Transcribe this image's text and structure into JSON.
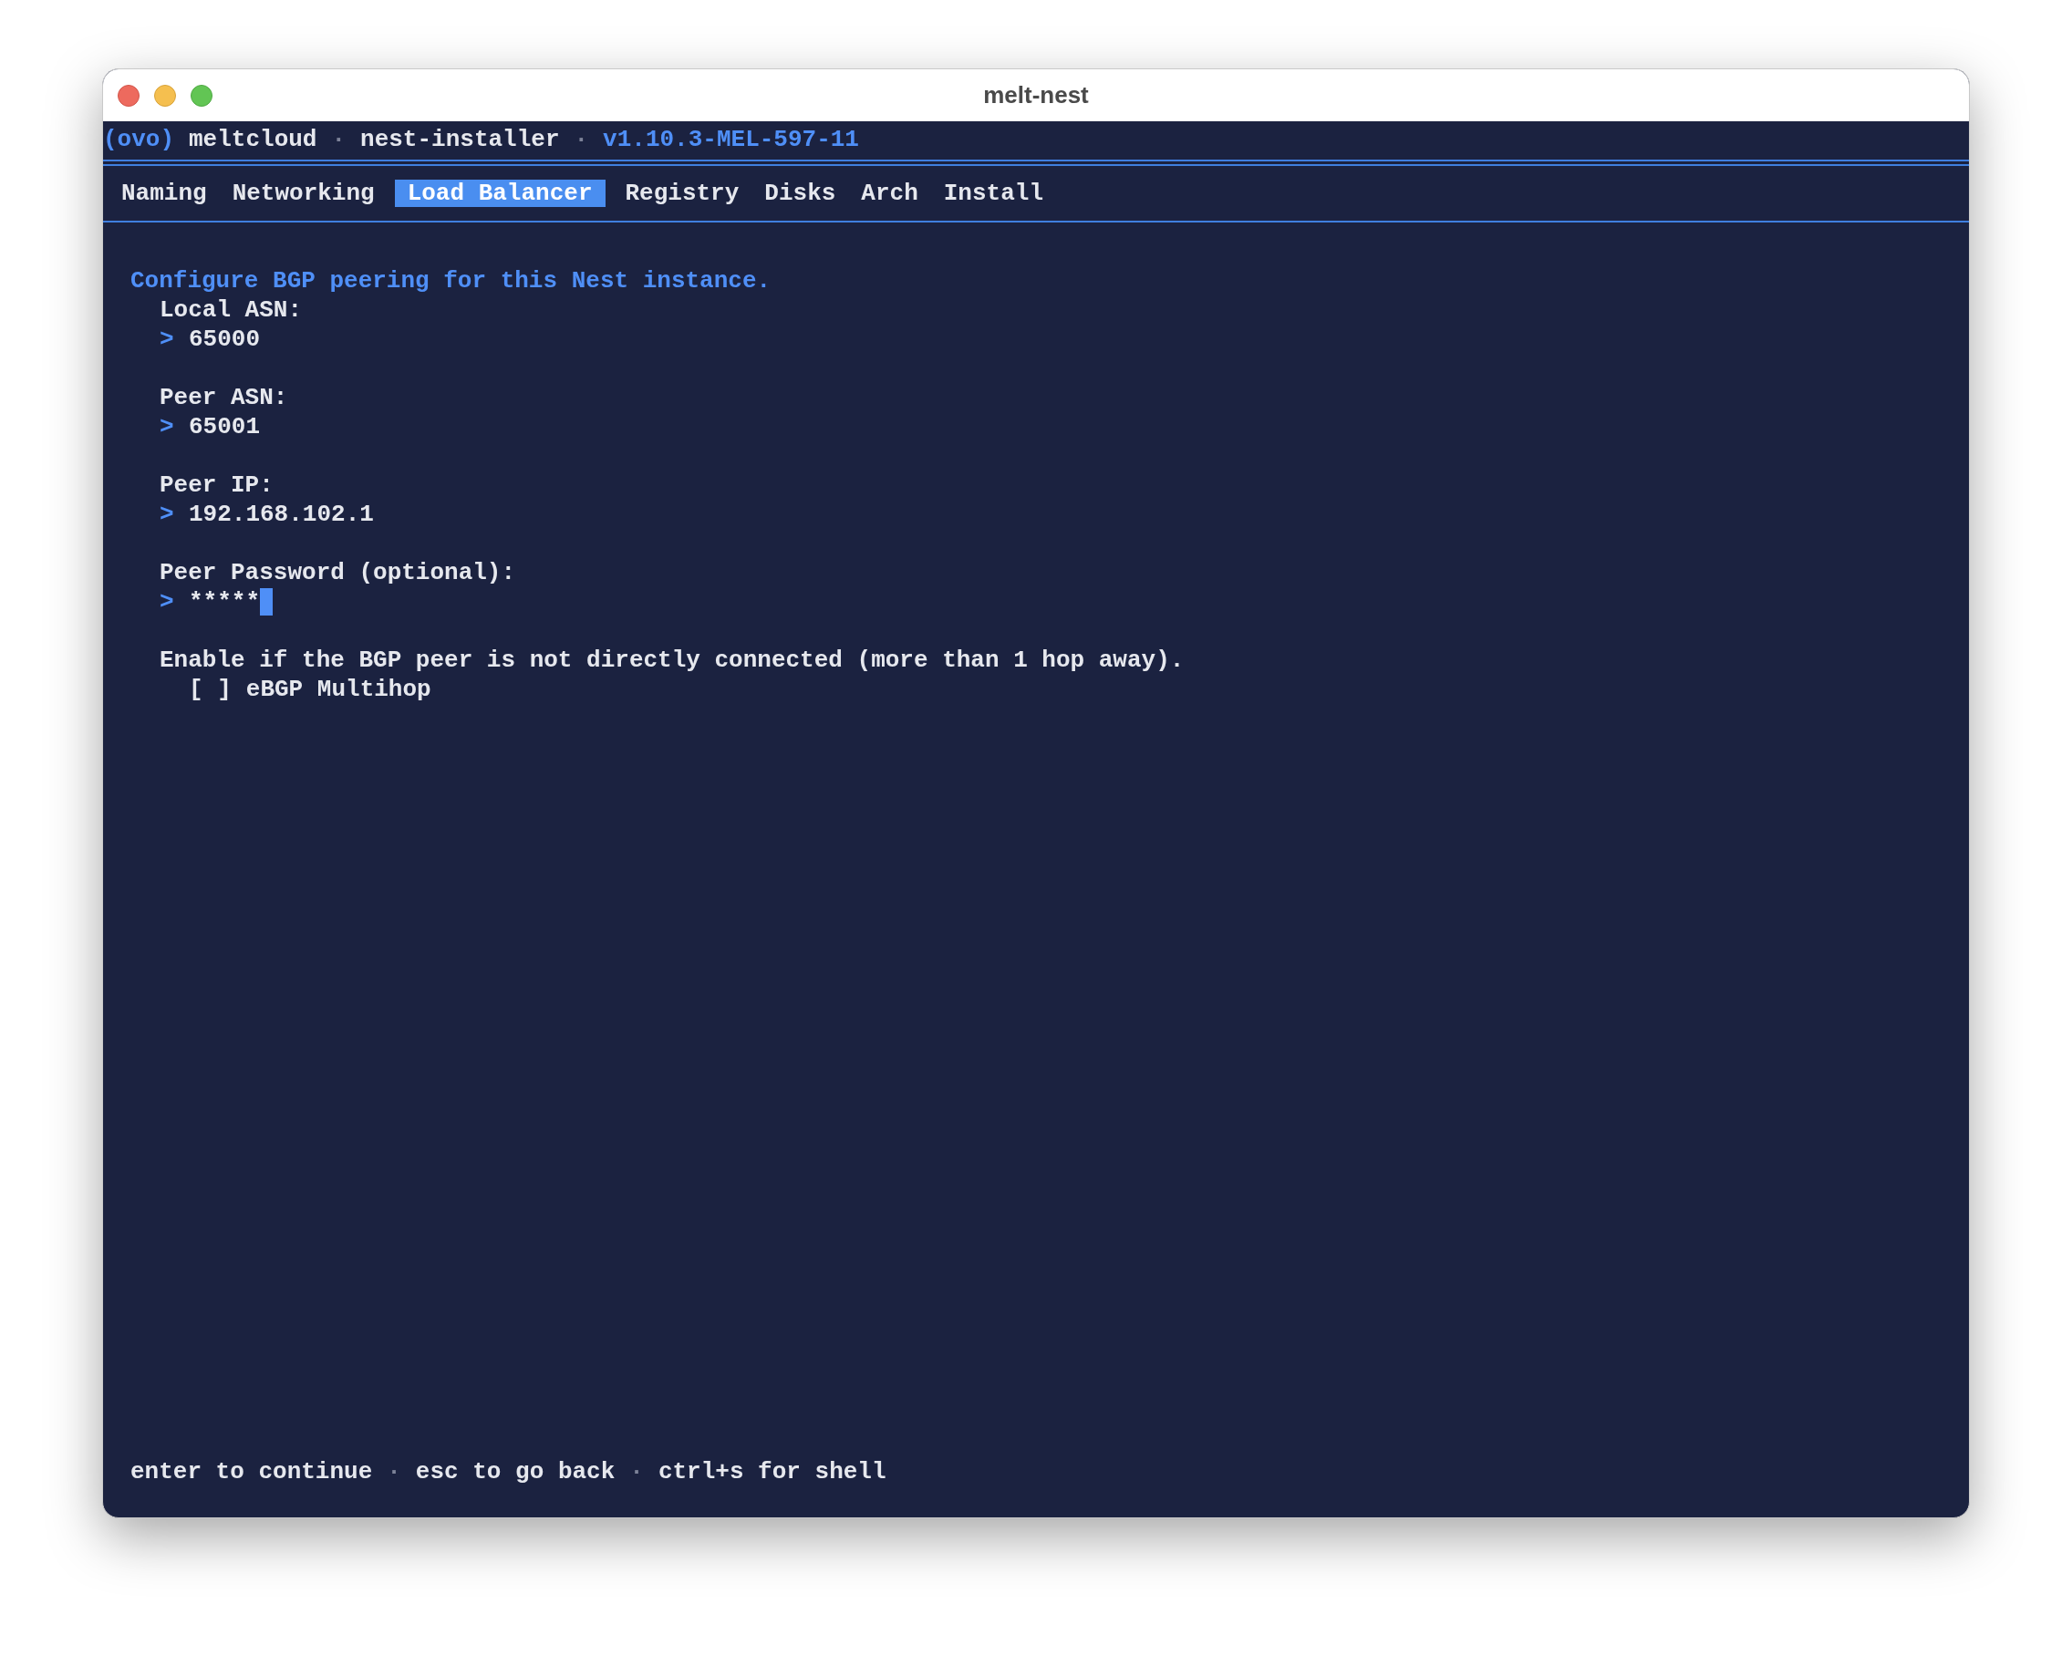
{
  "window": {
    "title": "melt-nest"
  },
  "header": [
    {
      "text": "(ovo)",
      "kind": "accent"
    },
    {
      "text": "meltcloud",
      "kind": "plain"
    },
    {
      "text": "·",
      "kind": "separator"
    },
    {
      "text": "nest-installer",
      "kind": "plain"
    },
    {
      "text": "·",
      "kind": "separator"
    },
    {
      "text": "v1.10.3-MEL-597-11",
      "kind": "accent"
    }
  ],
  "tabs": [
    {
      "label": "Naming",
      "selected": false
    },
    {
      "label": "Networking",
      "selected": false
    },
    {
      "label": "Load Balancer",
      "selected": true
    },
    {
      "label": "Registry",
      "selected": false
    },
    {
      "label": "Disks",
      "selected": false
    },
    {
      "label": "Arch",
      "selected": false
    },
    {
      "label": "Install",
      "selected": false
    }
  ],
  "form": {
    "intro": "Configure BGP peering for this Nest instance.",
    "fields": [
      {
        "kind": "input",
        "label": "Local ASN:",
        "prompt": ">",
        "value": "65000",
        "focused": false
      },
      {
        "kind": "input",
        "label": "Peer ASN:",
        "prompt": ">",
        "value": "65001",
        "focused": false
      },
      {
        "kind": "input",
        "label": "Peer IP:",
        "prompt": ">",
        "value": "192.168.102.1",
        "focused": false
      },
      {
        "kind": "input",
        "label": "Peer Password (optional):",
        "prompt": ">",
        "value": "*****",
        "focused": true
      },
      {
        "kind": "checkbox",
        "label": "Enable if the BGP peer is not directly connected (more than 1 hop away).",
        "box": "[ ]",
        "option": "eBGP Multihop",
        "checked": false
      }
    ]
  },
  "footer": [
    {
      "text": "enter to continue",
      "kind": "plain"
    },
    {
      "text": "·",
      "kind": "separator"
    },
    {
      "text": "esc to go back",
      "kind": "plain"
    },
    {
      "text": "·",
      "kind": "separator"
    },
    {
      "text": "ctrl+s for shell",
      "kind": "plain"
    }
  ]
}
